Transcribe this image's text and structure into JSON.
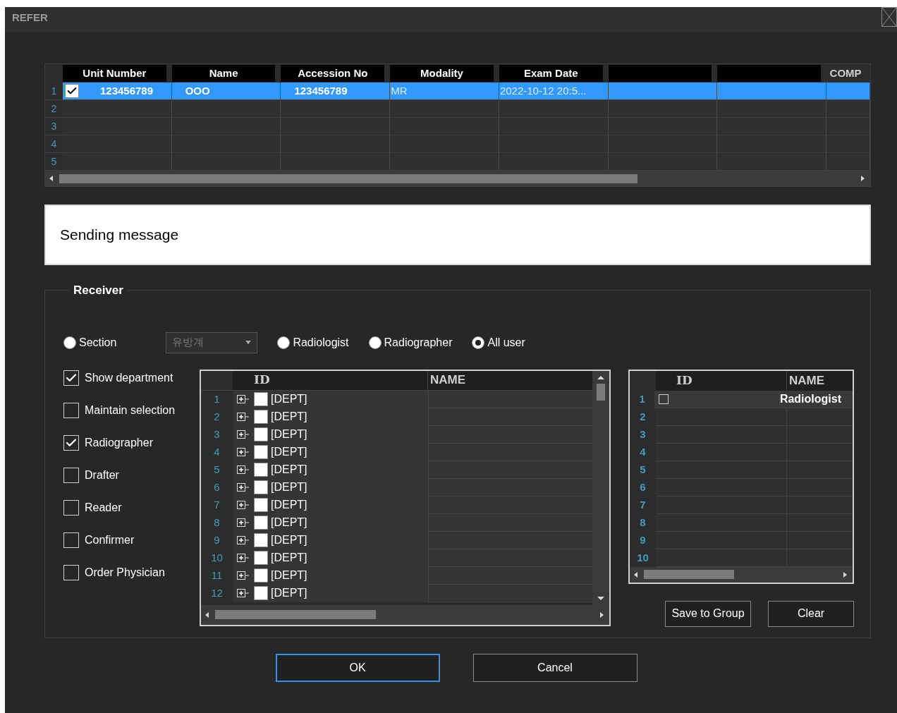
{
  "window": {
    "title": "REFER"
  },
  "exam_table": {
    "columns": [
      {
        "label": "Unit Number"
      },
      {
        "label": "Name"
      },
      {
        "label": "Accession No"
      },
      {
        "label": "Modality"
      },
      {
        "label": "Exam Date"
      },
      {},
      {},
      {
        "label": "COMP"
      }
    ],
    "rows": [
      {
        "number": "1",
        "selected": true,
        "cells": [
          {
            "text": "123456789",
            "checked": true
          },
          {
            "text": "OOO"
          },
          {
            "text": "123456789"
          },
          {
            "text": "MR"
          },
          {
            "text": "2022-10-12 20:5..."
          },
          {},
          {},
          {}
        ]
      },
      {
        "number": "2",
        "selected": false
      },
      {
        "number": "3",
        "selected": false
      },
      {
        "number": "4",
        "selected": false
      },
      {
        "number": "5",
        "selected": false
      }
    ]
  },
  "message": {
    "text": "Sending message"
  },
  "receiver": {
    "legend": "Receiver",
    "radios": [
      {
        "label": "Section",
        "selected": false,
        "dropdown": {
          "value": "유방계",
          "disabled": true
        }
      },
      {
        "label": "Radiologist",
        "selected": false
      },
      {
        "label": "Radiographer",
        "selected": false
      },
      {
        "label": "All user",
        "selected": true
      }
    ],
    "options": [
      {
        "label": "Show department",
        "checked": true
      },
      {
        "label": "Maintain selection",
        "checked": false
      },
      {
        "label": "Radiographer",
        "checked": true
      },
      {
        "label": "Drafter",
        "checked": false
      },
      {
        "label": "Reader",
        "checked": false
      },
      {
        "label": "Confirmer",
        "checked": false
      },
      {
        "label": "Order Physician",
        "checked": false
      }
    ],
    "department_grid": {
      "columns": [
        "ID",
        "NAME"
      ],
      "rows": [
        {
          "number": "1",
          "id": "[DEPT]",
          "checked": false,
          "expanded": false
        },
        {
          "number": "2",
          "id": "[DEPT]",
          "checked": false,
          "expanded": false
        },
        {
          "number": "3",
          "id": "[DEPT]",
          "checked": false,
          "expanded": false
        },
        {
          "number": "4",
          "id": "[DEPT]",
          "checked": false,
          "expanded": false
        },
        {
          "number": "5",
          "id": "[DEPT]",
          "checked": false,
          "expanded": false
        },
        {
          "number": "6",
          "id": "[DEPT]",
          "checked": false,
          "expanded": false
        },
        {
          "number": "7",
          "id": "[DEPT]",
          "checked": false,
          "expanded": false
        },
        {
          "number": "8",
          "id": "[DEPT]",
          "checked": false,
          "expanded": false
        },
        {
          "number": "9",
          "id": "[DEPT]",
          "checked": false,
          "expanded": false
        },
        {
          "number": "10",
          "id": "[DEPT]",
          "checked": false,
          "expanded": false
        },
        {
          "number": "11",
          "id": "[DEPT]",
          "checked": false,
          "expanded": false
        },
        {
          "number": "12",
          "id": "[DEPT]",
          "checked": false,
          "expanded": false
        }
      ]
    },
    "recipient_grid": {
      "columns": [
        "ID",
        "NAME"
      ],
      "rows": [
        {
          "number": "1",
          "checked": false,
          "name": "Radiologist"
        },
        {
          "number": "2"
        },
        {
          "number": "3"
        },
        {
          "number": "4"
        },
        {
          "number": "5"
        },
        {
          "number": "6"
        },
        {
          "number": "7"
        },
        {
          "number": "8"
        },
        {
          "number": "9"
        },
        {
          "number": "10"
        }
      ]
    },
    "buttons": [
      {
        "label": "Save to Group"
      },
      {
        "label": "Clear"
      }
    ]
  },
  "footer_buttons": [
    {
      "label": "OK",
      "focused": true
    },
    {
      "label": "Cancel",
      "focused": false
    }
  ]
}
